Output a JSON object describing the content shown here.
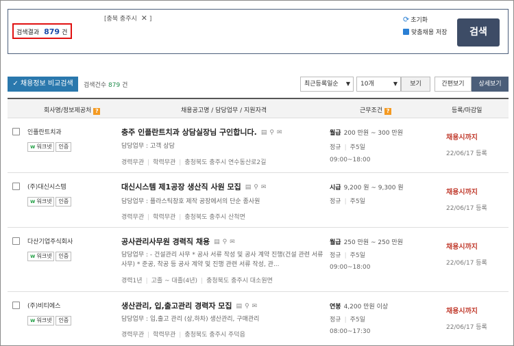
{
  "search": {
    "filter_tag": "[충북 충주시",
    "filter_tag_close": "]",
    "result_label": "검색결과",
    "result_count": "879",
    "result_unit": "건",
    "reset_label": "초기화",
    "save_label": "맞춤채용 저장",
    "search_button": "검색"
  },
  "toolbar": {
    "compare_button": "채용정보 비교검색",
    "count_label": "검색건수",
    "count_value": "879",
    "count_unit": "건",
    "sort_selected": "최근등록일순",
    "per_page_selected": "10개",
    "view_button": "보기",
    "simple_view": "간편보기",
    "detail_view": "상세보기"
  },
  "table": {
    "headers": {
      "company": "회사명/정보제공처",
      "posting": "채용공고명 / 담당업무 / 지원자격",
      "conditions": "근무조건",
      "date": "등록/마감일"
    },
    "rows": [
      {
        "company": "인플란트치과",
        "source": "워크넷",
        "cert": "인증",
        "title": "충주 인플란트치과 상담실장님 구인합니다.",
        "duty": "담당업무 : 고객 상담",
        "career": "경력무관",
        "education": "학력무관",
        "location": "충청북도 충주시 연수동산로2길",
        "pay_type": "월급",
        "pay": "200 만원 ~ 300 만원",
        "employment": "정규",
        "workdays": "주5일",
        "hours": "09:00~18:00",
        "deadline": "채용시까지",
        "registered": "22/06/17 등록"
      },
      {
        "company": "(주)대신시스템",
        "source": "워크넷",
        "cert": "인증",
        "title": "대신시스템 제1공장 생산직 사원 모집",
        "duty": "담당업무 : 플라스틱창호 제작 공장에서의 단순 종사원",
        "career": "경력무관",
        "education": "학력무관",
        "location": "충청북도 충주시 산척면",
        "pay_type": "시급",
        "pay": "9,200 원 ~ 9,300 원",
        "employment": "정규",
        "workdays": "주5일",
        "hours": "",
        "deadline": "채용시까지",
        "registered": "22/06/17 등록"
      },
      {
        "company": "다산기업주식회사",
        "source": "워크넷",
        "cert": "인증",
        "title": "공사관리사무원 경력직 채용",
        "duty": "담당업무 : - 건설관리 사무 * 공사 서류 작성 및 공사 계약 진행(건설 관련 서류 사무) * 준공, 착공 등 공사 계약 및 진행 관련 서류 작성, 관...",
        "career": "경력1년",
        "education": "고졸 ~ 대졸(4년)",
        "location": "충청북도 충주시 대소원면",
        "pay_type": "월급",
        "pay": "250 만원 ~ 250 만원",
        "employment": "정규",
        "workdays": "주5일",
        "hours": "09:00~18:00",
        "deadline": "채용시까지",
        "registered": "22/06/17 등록"
      },
      {
        "company": "(주)비티에스",
        "source": "워크넷",
        "cert": "인증",
        "title": "생산관리, 입,출고관리 경력자 모집",
        "duty": "담당업무 : 입,출고 관리 (상,하차) 생산관리, 구매관리",
        "career": "경력무관",
        "education": "학력무관",
        "location": "충청북도 충주시 주덕읍",
        "pay_type": "연봉",
        "pay": "4,200 만원 이상",
        "employment": "정규",
        "workdays": "주5일",
        "hours": "08:00~17:30",
        "deadline": "채용시까지",
        "registered": "22/06/17 등록"
      }
    ]
  },
  "colors": {
    "accent_navy": "#3d4c66",
    "compare_blue": "#2a78ad",
    "deadline_red": "#c0392b",
    "highlight_border": "#e01010"
  }
}
